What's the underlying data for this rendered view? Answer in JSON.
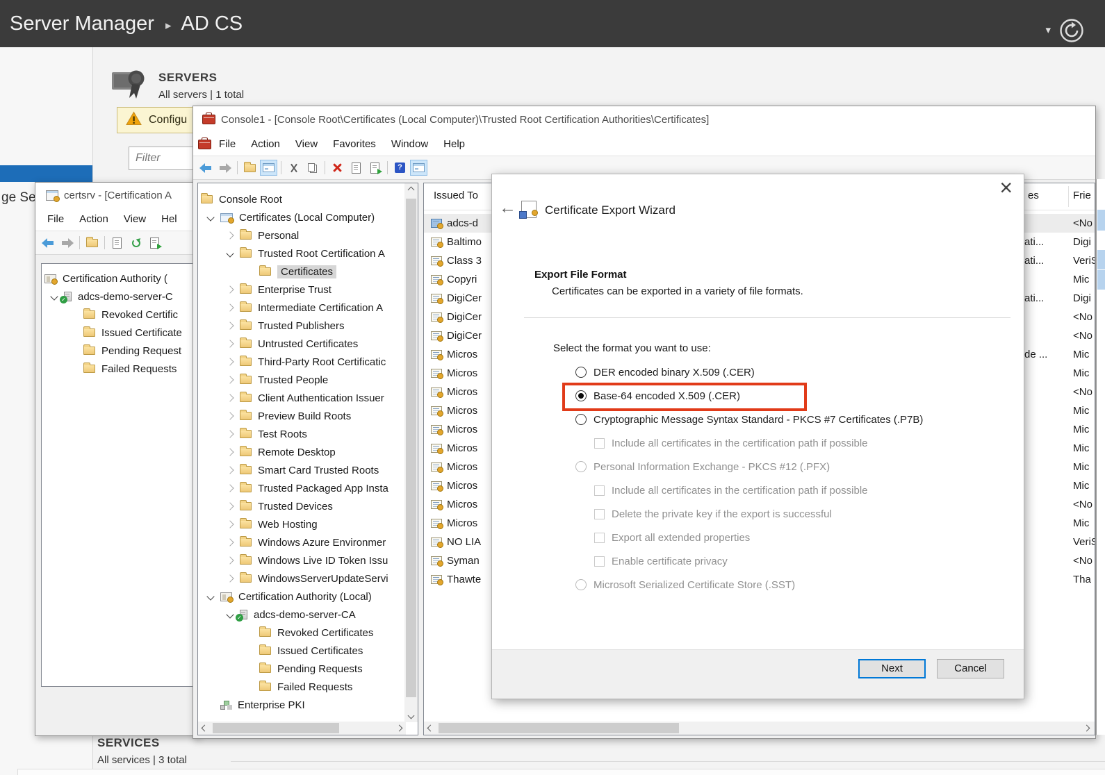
{
  "colors": {
    "accent_blue": "#1d6db8",
    "highlight_red": "#e13b19",
    "focus_blue": "#0078d7",
    "warning_bg": "#fbf5d2",
    "titlebar_dark": "#3b3b3b"
  },
  "server_manager": {
    "title": "Server Manager",
    "breadcrumb_arrow": "▸",
    "breadcrumb": "AD CS",
    "caret": "▾",
    "sidebar_partial_text": "ge Se",
    "servers": {
      "heading": "SERVERS",
      "subtext": "All servers | 1 total"
    },
    "warning_label": "Configu",
    "filter_placeholder": "Filter",
    "services": {
      "heading": "SERVICES",
      "subtext": "All services | 3 total"
    }
  },
  "certsrv_window": {
    "title": "certsrv - [Certification A",
    "menus": [
      "File",
      "Action",
      "View",
      "Hel"
    ],
    "toolbar_icons": [
      "back",
      "forward",
      "separator",
      "folder",
      "separator",
      "doc",
      "refresh",
      "export"
    ],
    "tree": [
      {
        "label": "Certification Authority (",
        "level": 0,
        "chev": "",
        "icon": "ca"
      },
      {
        "label": "adcs-demo-server-C",
        "level": 1,
        "chev": "v",
        "icon": "server"
      },
      {
        "label": "Revoked Certific",
        "level": 2,
        "chev": "",
        "icon": "folder"
      },
      {
        "label": "Issued Certificate",
        "level": 2,
        "chev": "",
        "icon": "folder"
      },
      {
        "label": "Pending Request",
        "level": 2,
        "chev": "",
        "icon": "folder"
      },
      {
        "label": "Failed Requests",
        "level": 2,
        "chev": "",
        "icon": "folder"
      }
    ]
  },
  "console_window": {
    "title": "Console1 - [Console Root\\Certificates (Local Computer)\\Trusted Root Certification Authorities\\Certificates]",
    "menus": [
      "File",
      "Action",
      "View",
      "Favorites",
      "Window",
      "Help"
    ],
    "toolbar_icons": [
      "back",
      "forward",
      "separator",
      "folder",
      "winlist-hl",
      "separator",
      "scissors",
      "copy",
      "separator",
      "xdel",
      "doc",
      "export",
      "separator",
      "help",
      "winlist-hl"
    ],
    "tree": [
      {
        "label": "Console Root",
        "level": 0,
        "chev": "",
        "icon": "folder"
      },
      {
        "label": "Certificates (Local Computer)",
        "level": 1,
        "chev": "v",
        "icon": "certstore"
      },
      {
        "label": "Personal",
        "level": 2,
        "chev": ">",
        "icon": "folder"
      },
      {
        "label": "Trusted Root Certification A",
        "level": 2,
        "chev": "v",
        "icon": "folder"
      },
      {
        "label": "Certificates",
        "level": 3,
        "chev": "",
        "icon": "folder",
        "selected": true
      },
      {
        "label": "Enterprise Trust",
        "level": 2,
        "chev": ">",
        "icon": "folder"
      },
      {
        "label": "Intermediate Certification A",
        "level": 2,
        "chev": ">",
        "icon": "folder"
      },
      {
        "label": "Trusted Publishers",
        "level": 2,
        "chev": ">",
        "icon": "folder"
      },
      {
        "label": "Untrusted Certificates",
        "level": 2,
        "chev": ">",
        "icon": "folder"
      },
      {
        "label": "Third-Party Root Certificatic",
        "level": 2,
        "chev": ">",
        "icon": "folder"
      },
      {
        "label": "Trusted People",
        "level": 2,
        "chev": ">",
        "icon": "folder"
      },
      {
        "label": "Client Authentication Issuer",
        "level": 2,
        "chev": ">",
        "icon": "folder"
      },
      {
        "label": "Preview Build Roots",
        "level": 2,
        "chev": ">",
        "icon": "folder"
      },
      {
        "label": "Test Roots",
        "level": 2,
        "chev": ">",
        "icon": "folder"
      },
      {
        "label": "Remote Desktop",
        "level": 2,
        "chev": ">",
        "icon": "folder"
      },
      {
        "label": "Smart Card Trusted Roots",
        "level": 2,
        "chev": ">",
        "icon": "folder"
      },
      {
        "label": "Trusted Packaged App Insta",
        "level": 2,
        "chev": ">",
        "icon": "folder"
      },
      {
        "label": "Trusted Devices",
        "level": 2,
        "chev": ">",
        "icon": "folder"
      },
      {
        "label": "Web Hosting",
        "level": 2,
        "chev": ">",
        "icon": "folder"
      },
      {
        "label": "Windows Azure Environmer",
        "level": 2,
        "chev": ">",
        "icon": "folder"
      },
      {
        "label": "Windows Live ID Token Issu",
        "level": 2,
        "chev": ">",
        "icon": "folder"
      },
      {
        "label": "WindowsServerUpdateServi",
        "level": 2,
        "chev": ">",
        "icon": "folder"
      },
      {
        "label": "Certification Authority (Local)",
        "level": 1,
        "chev": "v",
        "icon": "ca"
      },
      {
        "label": "adcs-demo-server-CA",
        "level": 2,
        "chev": "v",
        "icon": "server"
      },
      {
        "label": "Revoked Certificates",
        "level": 3,
        "chev": "",
        "icon": "folder"
      },
      {
        "label": "Issued Certificates",
        "level": 3,
        "chev": "",
        "icon": "folder"
      },
      {
        "label": "Pending Requests",
        "level": 3,
        "chev": "",
        "icon": "folder"
      },
      {
        "label": "Failed Requests",
        "level": 3,
        "chev": "",
        "icon": "folder"
      },
      {
        "label": "Enterprise PKI",
        "level": 1,
        "chev": "",
        "icon": "pki"
      }
    ],
    "list": {
      "header": "Issued To",
      "rows": [
        {
          "label": "adcs-d",
          "selected": true
        },
        {
          "label": "Baltimo"
        },
        {
          "label": "Class 3"
        },
        {
          "label": "Copyri"
        },
        {
          "label": "DigiCer"
        },
        {
          "label": "DigiCer"
        },
        {
          "label": "DigiCer"
        },
        {
          "label": "Micros"
        },
        {
          "label": "Micros"
        },
        {
          "label": "Micros"
        },
        {
          "label": "Micros"
        },
        {
          "label": "Micros"
        },
        {
          "label": "Micros"
        },
        {
          "label": "Micros"
        },
        {
          "label": "Micros"
        },
        {
          "label": "Micros"
        },
        {
          "label": "Micros"
        },
        {
          "label": "NO LIA"
        },
        {
          "label": "Syman"
        },
        {
          "label": "Thawte"
        }
      ]
    },
    "right_panel": {
      "col1_header": "es",
      "col2_header": "Frie",
      "rows": [
        {
          "purposes": "",
          "friendly": "<No"
        },
        {
          "purposes": "ati...",
          "friendly": "Digi"
        },
        {
          "purposes": "ati...",
          "friendly": "VeriS"
        },
        {
          "purposes": "",
          "friendly": "Mic"
        },
        {
          "purposes": "ati...",
          "friendly": "Digi"
        },
        {
          "purposes": "",
          "friendly": "<No"
        },
        {
          "purposes": "",
          "friendly": "<No"
        },
        {
          "purposes": "de ...",
          "friendly": "Mic"
        },
        {
          "purposes": "",
          "friendly": "Mic"
        },
        {
          "purposes": "",
          "friendly": "<No"
        },
        {
          "purposes": "",
          "friendly": "Mic"
        },
        {
          "purposes": "",
          "friendly": "Mic"
        },
        {
          "purposes": "",
          "friendly": "Mic"
        },
        {
          "purposes": "",
          "friendly": "Mic"
        },
        {
          "purposes": "",
          "friendly": "Mic"
        },
        {
          "purposes": "",
          "friendly": "<No"
        },
        {
          "purposes": "",
          "friendly": "Mic"
        },
        {
          "purposes": "",
          "friendly": "VeriS"
        },
        {
          "purposes": "",
          "friendly": "<No"
        },
        {
          "purposes": "",
          "friendly": "Tha"
        }
      ]
    }
  },
  "wizard": {
    "title": "Certificate Export Wizard",
    "back_glyph": "←",
    "close_glyph": "×",
    "heading": "Export File Format",
    "description": "Certificates can be exported in a variety of file formats.",
    "prompt": "Select the format you want to use:",
    "options": [
      {
        "type": "radio",
        "label": "DER encoded binary X.509 (.CER)",
        "enabled": true,
        "selected": false,
        "indent": 0
      },
      {
        "type": "radio",
        "label": "Base-64 encoded X.509 (.CER)",
        "enabled": true,
        "selected": true,
        "indent": 0,
        "highlighted": true
      },
      {
        "type": "radio",
        "label": "Cryptographic Message Syntax Standard - PKCS #7 Certificates (.P7B)",
        "enabled": true,
        "selected": false,
        "indent": 0
      },
      {
        "type": "checkbox",
        "label": "Include all certificates in the certification path if possible",
        "enabled": false,
        "indent": 1
      },
      {
        "type": "radio",
        "label": "Personal Information Exchange - PKCS #12 (.PFX)",
        "enabled": false,
        "selected": false,
        "indent": 0
      },
      {
        "type": "checkbox",
        "label": "Include all certificates in the certification path if possible",
        "enabled": false,
        "indent": 1
      },
      {
        "type": "checkbox",
        "label": "Delete the private key if the export is successful",
        "enabled": false,
        "indent": 1
      },
      {
        "type": "checkbox",
        "label": "Export all extended properties",
        "enabled": false,
        "indent": 1
      },
      {
        "type": "checkbox",
        "label": "Enable certificate privacy",
        "enabled": false,
        "indent": 1
      },
      {
        "type": "radio",
        "label": "Microsoft Serialized Certificate Store (.SST)",
        "enabled": false,
        "selected": false,
        "indent": 0
      }
    ],
    "buttons": {
      "next": "Next",
      "cancel": "Cancel"
    }
  }
}
